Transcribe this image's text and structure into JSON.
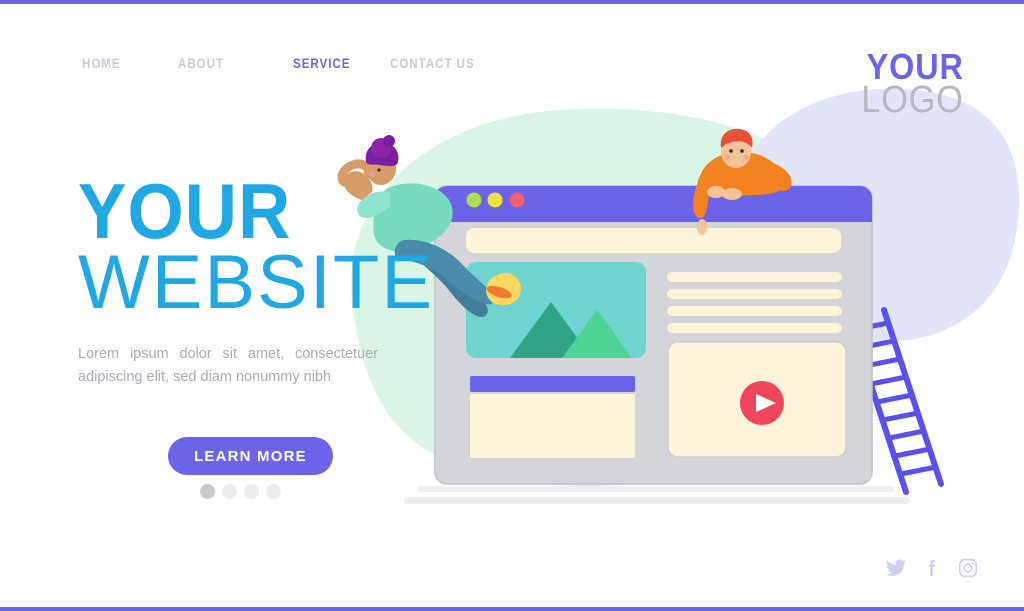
{
  "theme": {
    "accent_purple": "#6c63e8",
    "accent_cyan": "#1fa8e4",
    "muted_text": "#a9abb2",
    "nav_inactive": "#c9cbd4",
    "blob_mint": "#d9f5e6",
    "blob_lavender": "#e2e4f7",
    "browser_chrome": "#d3d5d8",
    "browser_titlebar": "#6c63e8",
    "card_cream": "#fdf4d9",
    "image_teal": "#6fd3cf",
    "play_red": "#f0465c",
    "ladder_blue": "#5b4ff0"
  },
  "frame": {
    "top_rule": "",
    "bottom_rule": ""
  },
  "nav": {
    "items": [
      {
        "label": "HOME",
        "active": false
      },
      {
        "label": "ABOUT",
        "active": false
      },
      {
        "label": "SERVICE",
        "active": true
      },
      {
        "label": "CONTACT US",
        "active": false
      }
    ]
  },
  "logo": {
    "line1": "YOUR",
    "line2": "LOGO"
  },
  "hero": {
    "heading_line1": "YOUR",
    "heading_line2": "WEBSITE",
    "paragraph": "Lorem ipsum dolor sit amet, consectetuer adipiscing elit, sed diam nonummy nibh",
    "cta_label": "LEARN MORE",
    "carousel": {
      "count": 4,
      "active_index": 0
    }
  },
  "illustration": {
    "browser_mockup": {
      "titlebar_dots": [
        {
          "name": "window-dot-green",
          "color": "#a7e04c"
        },
        {
          "name": "window-dot-yellow",
          "color": "#f2e03f"
        },
        {
          "name": "window-dot-red",
          "color": "#f4606e"
        }
      ],
      "banner_block": "",
      "image_placeholder": {
        "sun": "",
        "mountain_back": "",
        "mountain_front": ""
      },
      "text_lines": [
        "",
        "",
        "",
        ""
      ],
      "form_card": {
        "header_bar": "",
        "body": ""
      },
      "video_card": {
        "play_button": "play-icon"
      }
    },
    "characters": [
      {
        "name": "woman-lying-on-browser",
        "hair": "#7b1fa2",
        "shirt": "#78dbc0",
        "jeans": "#3f7f9c",
        "skin": "#d79c6a"
      },
      {
        "name": "man-leaning-over-browser",
        "hair": "#e8503a",
        "sweater": "#f58220",
        "skin": "#f6c29a"
      }
    ],
    "ladder": {
      "name": "ladder",
      "rungs": 10
    }
  },
  "social": {
    "items": [
      {
        "name": "twitter-icon"
      },
      {
        "name": "facebook-icon"
      },
      {
        "name": "instagram-icon"
      }
    ]
  }
}
